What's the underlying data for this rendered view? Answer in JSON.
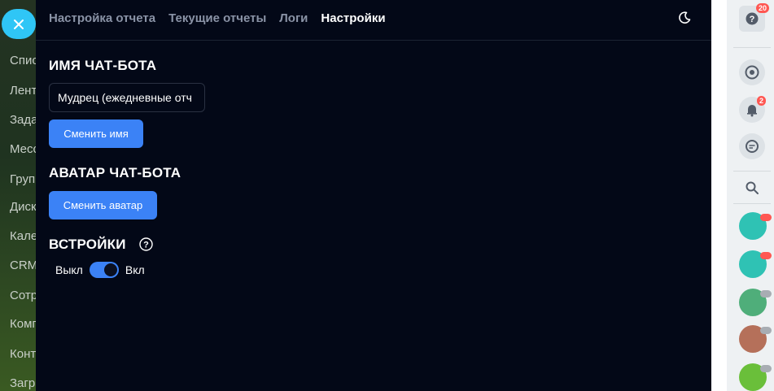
{
  "background_sidebar": {
    "items": [
      "Спис",
      "Лент",
      "Зада",
      "Месс",
      "Груп",
      "Диск",
      "Кале",
      "CRM",
      "Сотр",
      "Комп",
      "Конт",
      "Загр"
    ]
  },
  "tabs": [
    {
      "label": "Настройка отчета",
      "active": false
    },
    {
      "label": "Текущие отчеты",
      "active": false
    },
    {
      "label": "Логи",
      "active": false
    },
    {
      "label": "Настройки",
      "active": true
    }
  ],
  "bot_name": {
    "heading": "ИМЯ ЧАТ-БОТА",
    "value": "Мудрец (ежедневные отч",
    "button": "Сменить имя"
  },
  "bot_avatar": {
    "heading": "АВАТАР ЧАТ-БОТА",
    "button": "Сменить аватар"
  },
  "embed": {
    "heading": "ВСТРОЙКИ",
    "off_label": "Выкл",
    "on_label": "Вкл",
    "enabled": true
  },
  "rightbar": {
    "help_badge": "20",
    "notifications_badge": "2"
  },
  "colors": {
    "panel_bg": "#030817",
    "accent": "#3b82f6",
    "close_button": "#2fc6f6",
    "badge": "#ff5752"
  }
}
